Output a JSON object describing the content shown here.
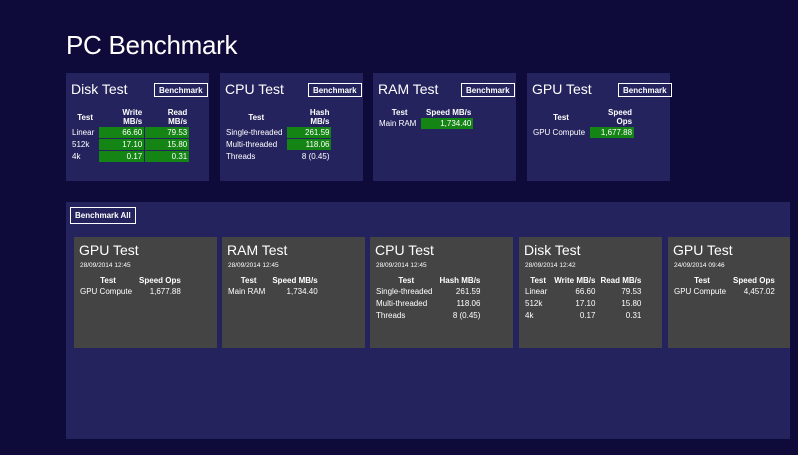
{
  "app": {
    "title": "PC Benchmark"
  },
  "live_tiles": [
    {
      "title": "Disk Test",
      "button": "Benchmark",
      "headers": [
        "Test",
        "Write MB/s",
        "Read MB/s"
      ],
      "rows": [
        [
          "Linear",
          "66.60",
          "79.53"
        ],
        [
          "512k",
          "17.10",
          "15.80"
        ],
        [
          "4k",
          "0.17",
          "0.31"
        ]
      ]
    },
    {
      "title": "CPU Test",
      "button": "Benchmark",
      "headers": [
        "Test",
        "Hash MB/s"
      ],
      "rows": [
        [
          "Single-threaded",
          "261.59"
        ],
        [
          "Multi-threaded",
          "118.06"
        ],
        [
          "Threads",
          "8 (0.45)"
        ]
      ]
    },
    {
      "title": "RAM Test",
      "button": "Benchmark",
      "headers": [
        "Test",
        "Speed MB/s"
      ],
      "rows": [
        [
          "Main RAM",
          "1,734.40"
        ]
      ]
    },
    {
      "title": "GPU Test",
      "button": "Benchmark",
      "headers": [
        "Test",
        "Speed Ops"
      ],
      "rows": [
        [
          "GPU Compute",
          "1,677.88"
        ]
      ]
    }
  ],
  "history": {
    "button": "Benchmark All",
    "cards": [
      {
        "title": "GPU Test",
        "date": "28/09/2014 12:45",
        "headers": [
          "Test",
          "Speed Ops"
        ],
        "rows": [
          [
            "GPU Compute",
            "1,677.88"
          ]
        ]
      },
      {
        "title": "RAM Test",
        "date": "28/09/2014 12:45",
        "headers": [
          "Test",
          "Speed MB/s"
        ],
        "rows": [
          [
            "Main RAM",
            "1,734.40"
          ]
        ]
      },
      {
        "title": "CPU Test",
        "date": "28/09/2014 12:45",
        "headers": [
          "Test",
          "Hash MB/s"
        ],
        "rows": [
          [
            "Single-threaded",
            "261.59"
          ],
          [
            "Multi-threaded",
            "118.06"
          ],
          [
            "Threads",
            "8 (0.45)"
          ]
        ]
      },
      {
        "title": "Disk Test",
        "date": "28/09/2014 12:42",
        "headers": [
          "Test",
          "Write MB/s",
          "Read MB/s"
        ],
        "rows": [
          [
            "Linear",
            "66.60",
            "79.53"
          ],
          [
            "512k",
            "17.10",
            "15.80"
          ],
          [
            "4k",
            "0.17",
            "0.31"
          ]
        ]
      },
      {
        "title": "GPU Test",
        "date": "24/09/2014 09:46",
        "headers": [
          "Test",
          "Speed Ops"
        ],
        "rows": [
          [
            "GPU Compute",
            "4,457.02"
          ]
        ]
      }
    ]
  },
  "colors": {
    "background": "#0e0b3a",
    "panel": "#25235e",
    "card": "#444444",
    "highlight": "#148414",
    "text": "#ffffff"
  }
}
